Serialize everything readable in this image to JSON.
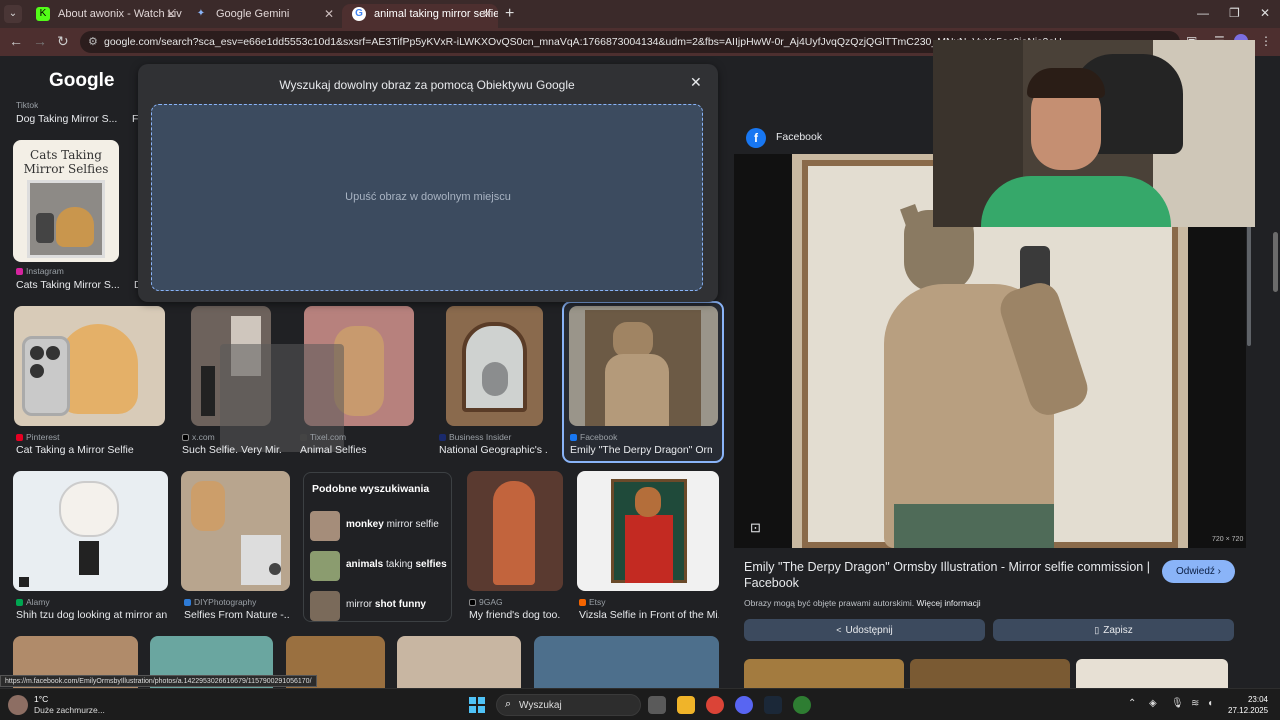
{
  "browser": {
    "tabs": [
      {
        "label": "About awonix - Watch Live on",
        "icon": "kick-icon",
        "active": false
      },
      {
        "label": "Google Gemini",
        "icon": "gemini-icon",
        "active": false
      },
      {
        "label": "animal taking mirror selfie - Sz",
        "icon": "google-icon",
        "active": true
      }
    ],
    "address": "google.com/search?sca_esv=e66e1dd5553c10d1&sxsrf=AE3TifPp5yKVxR-iLWKXOvQS0cn_mnaVqA:1766873004134&udm=2&fbs=AIIjpHwW-0r_Aj4UyfJvqQzQzjQGlTTmC230_MNxN_VvYo5oc8ioNjs2eU"
  },
  "page": {
    "logo": "Google",
    "lens": {
      "title": "Wyszukaj dowolny obraz za pomocą Obiektywu Google",
      "drop_text": "Upuść obraz w dowolnym miejscu"
    },
    "partial_row": {
      "items": [
        {
          "source": "Tiktok",
          "caption": "Dog Taking Mirror S..."
        },
        {
          "source": "",
          "caption": "F"
        }
      ]
    },
    "row1": [
      {
        "source": "Instagram",
        "caption": "Cats Taking Mirror S...",
        "thumb_text_1": "Cats Taking",
        "thumb_text_2": "Mirror Selfies"
      },
      {
        "source": "",
        "caption": "D"
      }
    ],
    "row2": [
      {
        "source": "Pinterest",
        "caption": "Cat Taking a Mirror Selfie"
      },
      {
        "source": "x.com",
        "caption": "Such Selfie. Very Mir..."
      },
      {
        "source": "Tixel.com",
        "caption": "Animal Selfies"
      },
      {
        "source": "Business Insider",
        "caption": "National Geographic's ..."
      },
      {
        "source": "Facebook",
        "caption": "Emily \"The Derpy Dragon\" Orm..."
      }
    ],
    "similar": {
      "title": "Podobne wyszukiwania",
      "items": [
        {
          "bold": "monkey",
          "rest": " mirror selfie"
        },
        {
          "bold": "animals",
          "rest": " taking ",
          "bold2": "selfies"
        },
        {
          "pre": "mirror ",
          "bold": "shot funny"
        }
      ]
    },
    "row3": [
      {
        "source": "Alamy",
        "caption": "Shih tzu dog looking at mirror an..."
      },
      {
        "source": "DIYPhotography",
        "caption": "Selfies From Nature -..."
      },
      {
        "source": "9GAG",
        "caption": "My friend's dog too..."
      },
      {
        "source": "Etsy",
        "caption": "Vizsla Selfie in Front of the Mi..."
      }
    ],
    "status_url": "https://m.facebook.com/EmilyOrmsbyIllustration/photos/a.1422953026616679/1157900291056170/"
  },
  "panel": {
    "source": "Facebook",
    "dims": "720 × 720",
    "title": "Emily \"The Derpy Dragon\" Ormsby Illustration - Mirror selfie commission | Facebook",
    "visit": "Odwiedź",
    "rights": "Obrazy mogą być objęte prawami autorskimi.",
    "rights_link": "Więcej informacji",
    "share": "Udostępnij",
    "save": "Zapisz"
  },
  "taskbar": {
    "temp": "1°C",
    "weather": "Duże zachmurze...",
    "search": "Wyszukaj",
    "time": "23:04",
    "date": "27.12.2025"
  },
  "colors": {
    "accent": "#8ab4f8",
    "tabbar": "#3b2a2a",
    "toolbar": "#4d2f2f",
    "page_bg": "#202124"
  }
}
